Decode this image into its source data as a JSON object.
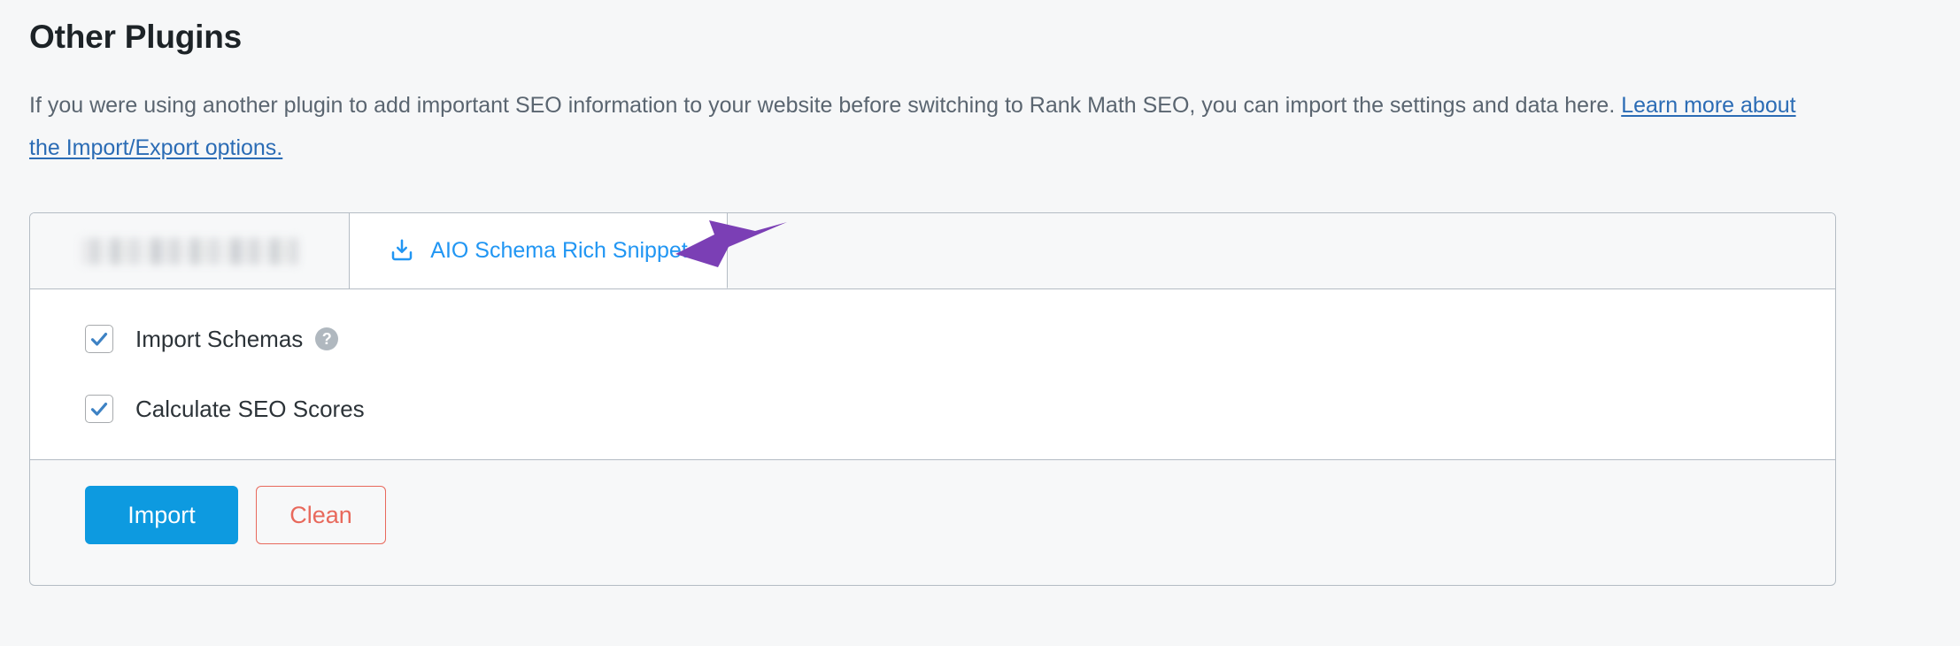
{
  "section": {
    "title": "Other Plugins",
    "description_before_link": "If you were using another plugin to add important SEO information to your website before switching to Rank Math SEO, you can import the settings and data here. ",
    "link_text": "Learn more about the Import/Export options."
  },
  "tabs": [
    {
      "id": "redacted-plugin-tab",
      "label": "",
      "redacted": true,
      "active": false,
      "icon": ""
    },
    {
      "id": "aio-schema-rich-snippet-tab",
      "label": "AIO Schema Rich Snippet",
      "redacted": false,
      "active": true,
      "icon": "import-download-icon"
    }
  ],
  "options": [
    {
      "label": "Import Schemas",
      "checked": true,
      "has_help": true,
      "help_glyph": "?"
    },
    {
      "label": "Calculate SEO Scores",
      "checked": true,
      "has_help": false,
      "help_glyph": ""
    }
  ],
  "footer": {
    "import_label": "Import",
    "clean_label": "Clean"
  },
  "annotation": {
    "type": "arrow",
    "direction": "left",
    "points_to": "AIO Schema Rich Snippet",
    "color": "#7b3fb5"
  },
  "colors": {
    "page_background": "#f6f7f8",
    "panel_border": "#b4bcc4",
    "tab_active_text": "#2196f3",
    "link": "#2b6cb5",
    "heading": "#1d2327",
    "body_text": "#5a6570",
    "checkbox_check": "#3d82c4",
    "import_button": "#0d9ae0",
    "clean_button": "#e8695c",
    "help_icon": "#b0b8bf",
    "annotation_arrow": "#7b3fb5"
  }
}
